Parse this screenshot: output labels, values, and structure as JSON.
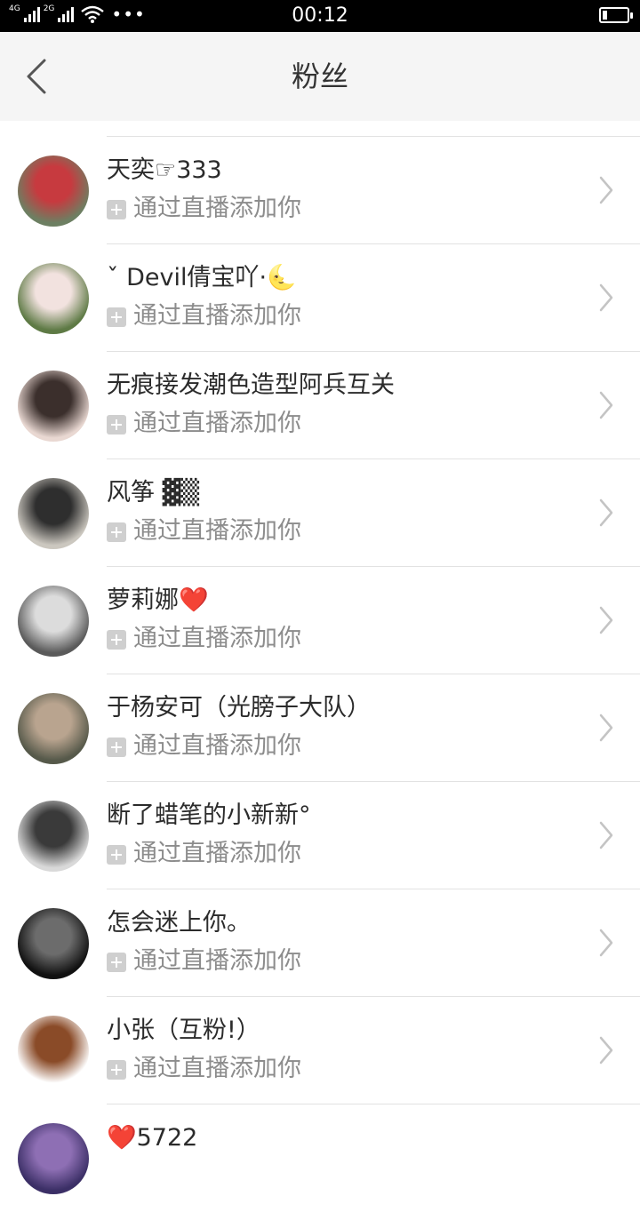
{
  "status_bar": {
    "network_1": "4G",
    "network_2": "2G",
    "dots": "•••",
    "time": "00:12",
    "battery_level": 0.2
  },
  "header": {
    "title": "粉丝",
    "back_icon": "chevron-left-icon"
  },
  "fans": [
    {
      "name": "天奕☞333",
      "source": "通过直播添加你",
      "avatar_colors": [
        "#6d7f62",
        "#c73a3f"
      ]
    },
    {
      "name": "ˇ Devil倩宝吖·🌜",
      "source": "通过直播添加你",
      "avatar_colors": [
        "#5e7a45",
        "#f2e2df"
      ]
    },
    {
      "name": "无痕接发潮色造型阿兵互关",
      "source": "通过直播添加你",
      "avatar_colors": [
        "#e9d8d2",
        "#3b2f2c"
      ]
    },
    {
      "name": "风筝 ▓▒",
      "source": "通过直播添加你",
      "avatar_colors": [
        "#cbc7bf",
        "#2e2e2e"
      ]
    },
    {
      "name": "萝莉娜❤️",
      "source": "通过直播添加你",
      "avatar_colors": [
        "#5a5a5a",
        "#dcdcdc"
      ]
    },
    {
      "name": "于杨安可（光膀子大队）",
      "source": "通过直播添加你",
      "avatar_colors": [
        "#56594a",
        "#b9a48f"
      ]
    },
    {
      "name": "断了蜡笔的小新新°",
      "source": "通过直播添加你",
      "avatar_colors": [
        "#d9d9d9",
        "#3a3a3a"
      ]
    },
    {
      "name": "怎会迷上你。",
      "source": "通过直播添加你",
      "avatar_colors": [
        "#111111",
        "#6c6c6c"
      ]
    },
    {
      "name": "小张（互粉!）",
      "source": "通过直播添加你",
      "avatar_colors": [
        "#ffffff",
        "#8a4b28"
      ]
    },
    {
      "name": "❤️5722",
      "source": "",
      "avatar_colors": [
        "#3b2f66",
        "#8e6fb4"
      ]
    }
  ]
}
